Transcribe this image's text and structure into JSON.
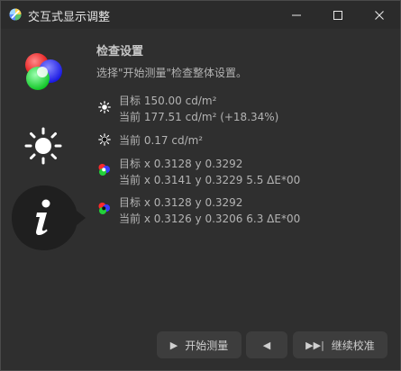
{
  "window": {
    "title": "交互式显示调整",
    "controls": [
      "minimize-icon",
      "maximize-icon",
      "close-icon"
    ]
  },
  "sidebar": {
    "items": [
      {
        "name": "rgb",
        "icon": "rgb-circles-icon"
      },
      {
        "name": "brightness",
        "icon": "sun-icon"
      },
      {
        "name": "info",
        "icon": "info-icon",
        "active": true
      }
    ]
  },
  "main": {
    "heading": "检查设置",
    "subheading": "选择\"开始测量\"检查整体设置。",
    "rows": [
      {
        "icon": "sun-small-icon",
        "line1": "目标 150.00 cd/m²",
        "line2": "当前 177.51 cd/m² (+18.34%)"
      },
      {
        "icon": "black-point-icon",
        "line1": "当前 0.17 cd/m²"
      },
      {
        "icon": "rgb-small-icon",
        "line1": "目标 x 0.3128 y 0.3292",
        "line2": "当前 x 0.3141 y 0.3229 5.5 ΔE*00"
      },
      {
        "icon": "rgb-dark-small-icon",
        "line1": "目标 x 0.3128 y 0.3292",
        "line2": "当前 x 0.3126 y 0.3206 6.3 ΔE*00"
      }
    ]
  },
  "footer": {
    "start_label": "开始测量",
    "back_label": "",
    "continue_label": "继续校准"
  },
  "colors": {
    "background": "#2f2f2f",
    "titlebar": "#2b2b2b",
    "button": "#3d3d3d",
    "active_tab": "#1f1f1f",
    "text": "#b3b3b3"
  }
}
